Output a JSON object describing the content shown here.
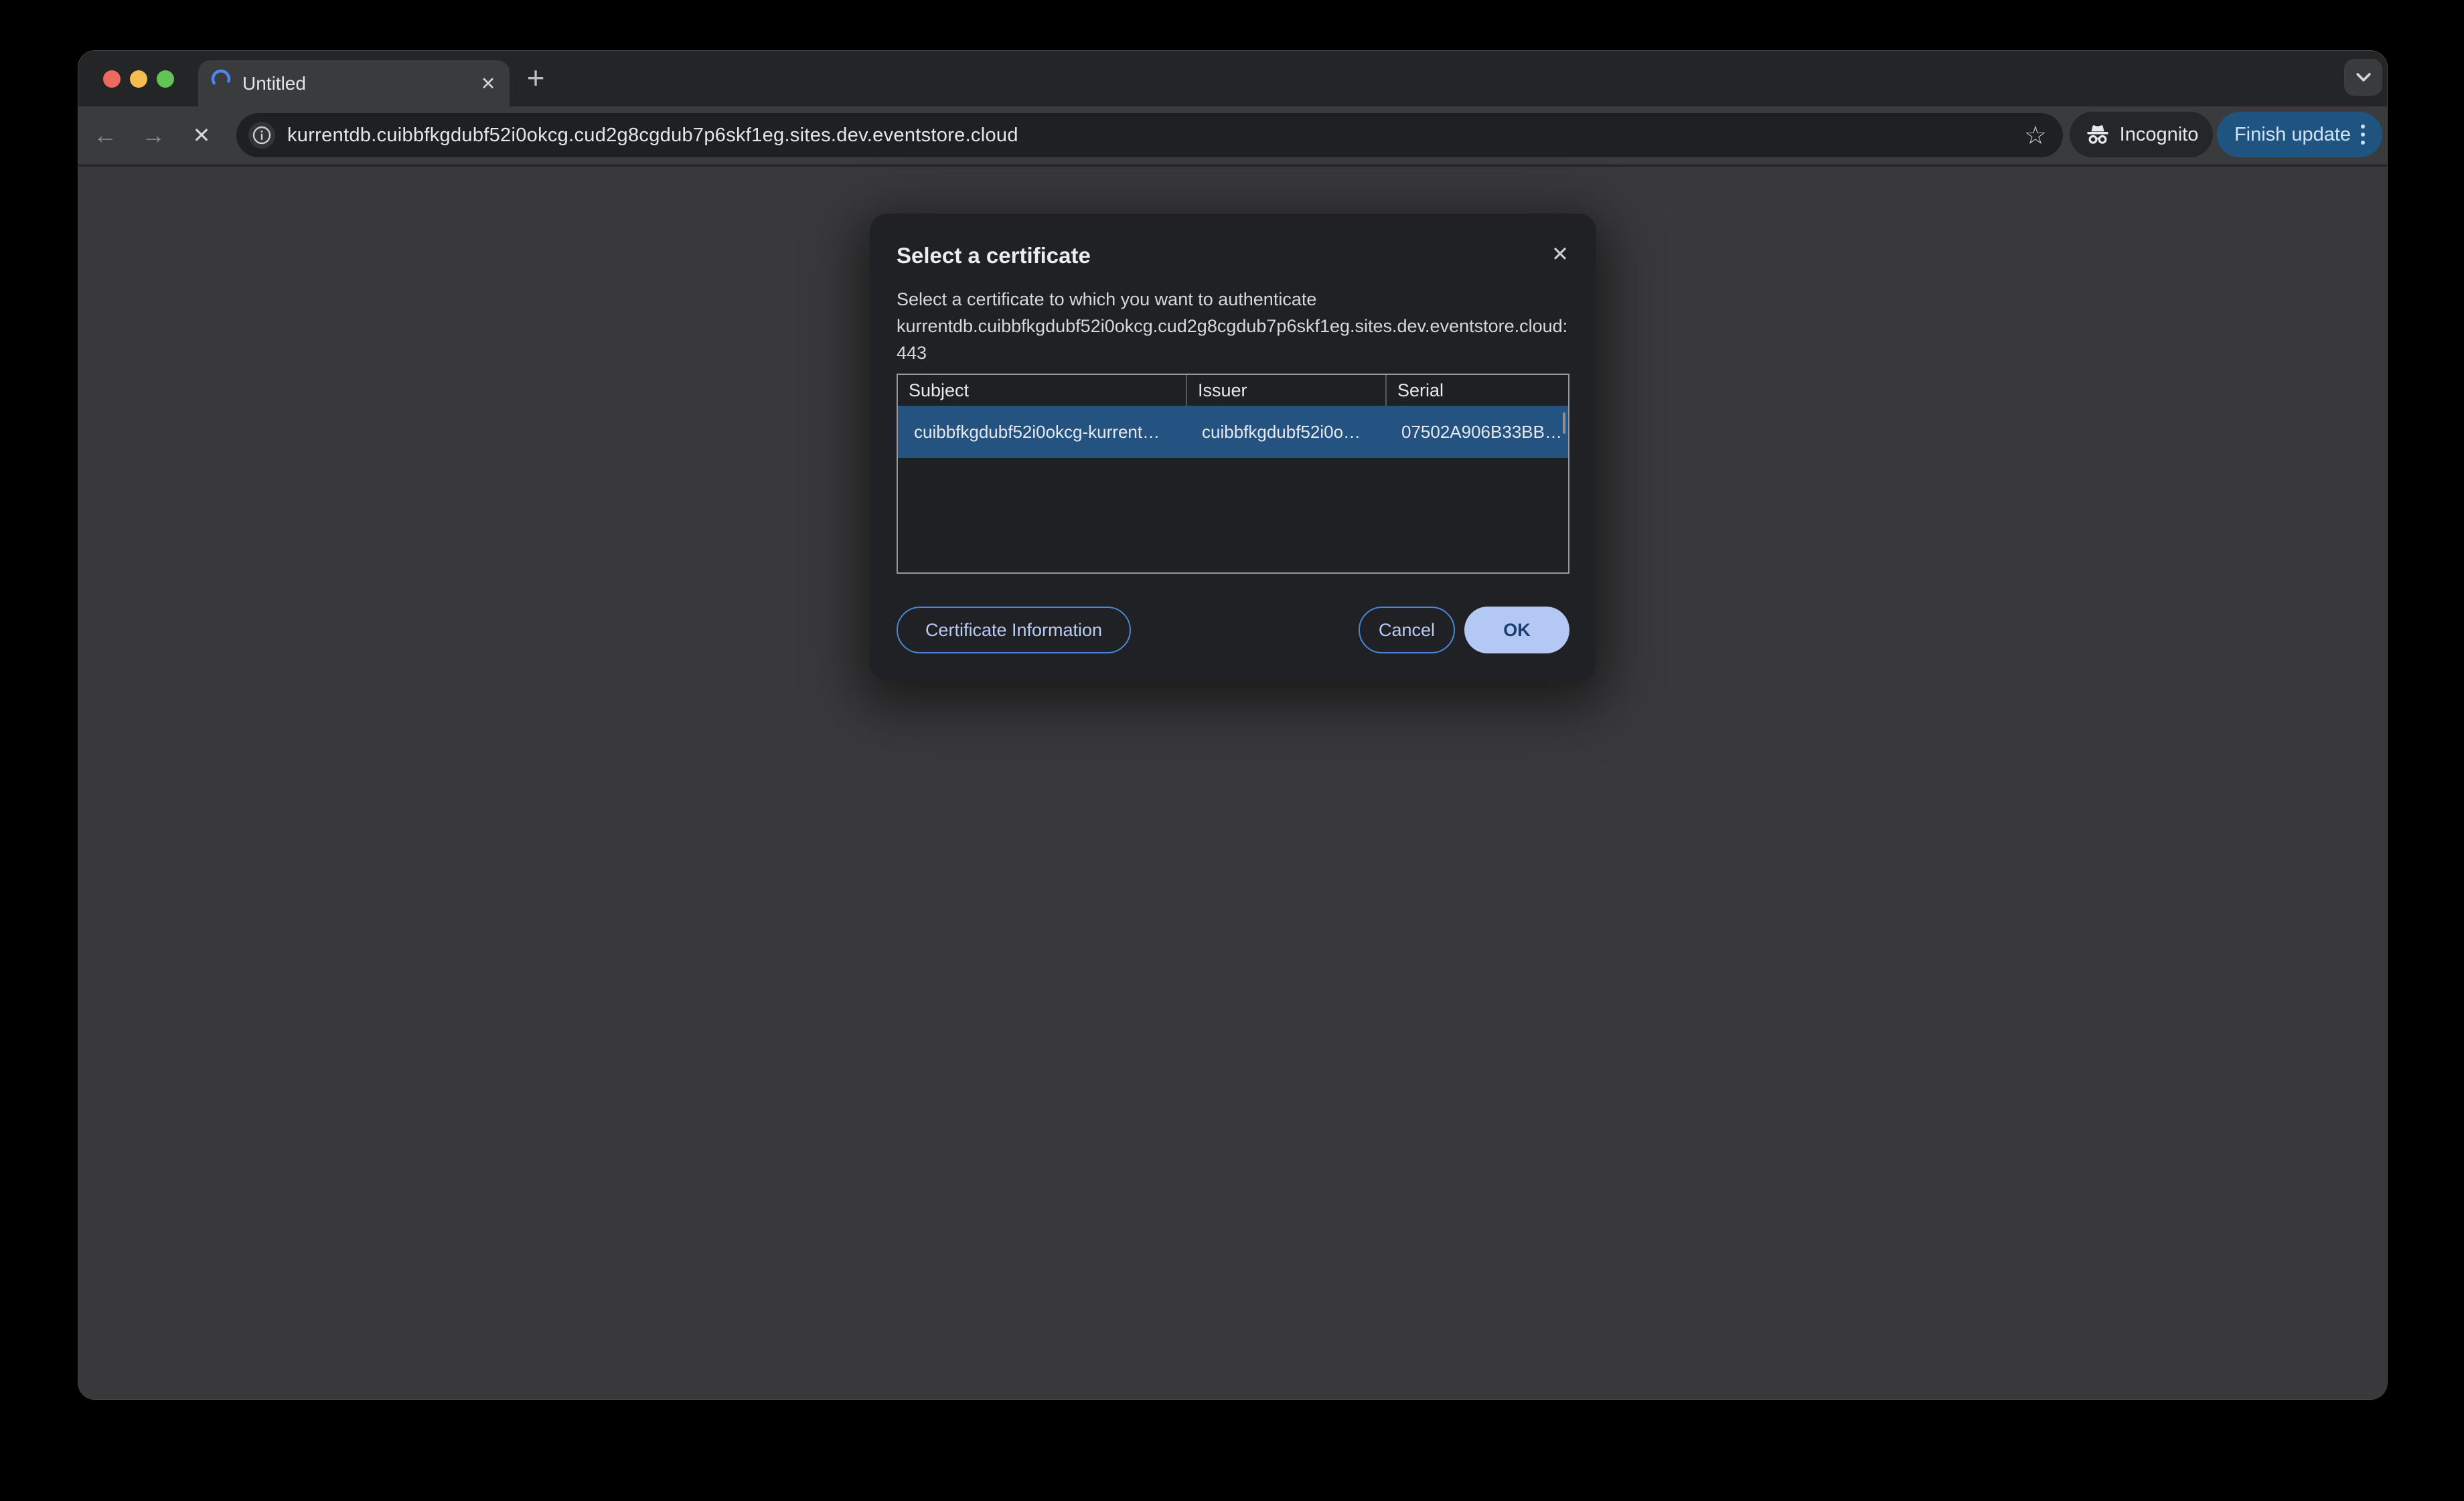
{
  "tab_bar": {
    "tab": {
      "label": "Untitled",
      "loading": true
    },
    "close_tab_icon": "✕",
    "new_tab_icon": "+"
  },
  "toolbar": {
    "back_icon": "←",
    "forward_icon": "→",
    "stop_icon": "✕",
    "url": "kurrentdb.cuibbfkgdubf52i0okcg.cud2g8cgdub7p6skf1eg.sites.dev.eventstore.cloud",
    "star_icon": "☆",
    "incognito_label": "Incognito",
    "update_button_label": "Finish update"
  },
  "dialog": {
    "title": "Select a certificate",
    "close_icon": "✕",
    "description": "Select a certificate to which you want to authenticate",
    "host": "kurrentdb.cuibbfkgdubf52i0okcg.cud2g8cgdub7p6skf1eg.sites.dev.eventstore.cloud:443",
    "table": {
      "columns": [
        "Subject",
        "Issuer",
        "Serial"
      ],
      "rows": [
        {
          "subject": "cuibbfkgdubf52i0okcg-kurrent…",
          "issuer": "cuibbfkgdubf52i0o…",
          "serial": "07502A906B33BB…",
          "selected": true
        }
      ]
    },
    "buttons": {
      "certificate_information": "Certificate Information",
      "cancel": "Cancel",
      "ok": "OK"
    }
  },
  "colors": {
    "selected_row": "#255381",
    "update_button": "#1f5380",
    "ok_button_fill": "#b4c8f4",
    "ok_button_text": "#1d3c72",
    "button_border": "#4a86d4",
    "button_text": "#b9ccf5",
    "spinner_blue": "#4e86ee",
    "traffic_red": "#ec6a5e",
    "traffic_yellow": "#f5bd4f",
    "traffic_green": "#62c454",
    "dialog_bg": "#202124",
    "page_bg": "#39393b",
    "toolbar_bg": "#3a3b3d"
  }
}
